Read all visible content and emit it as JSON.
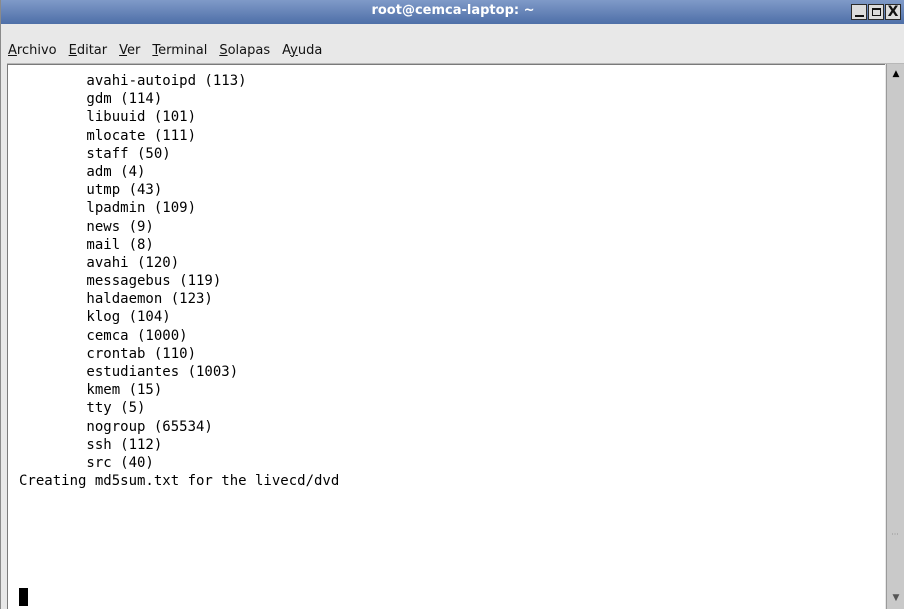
{
  "window": {
    "title": "root@cemca-laptop: ~",
    "minimize_label": "_",
    "maximize_label": "□",
    "close_label": "X"
  },
  "menubar": {
    "items": [
      {
        "label": "Archivo",
        "mnemonic": "A"
      },
      {
        "label": "Editar",
        "mnemonic": "E"
      },
      {
        "label": "Ver",
        "mnemonic": "V"
      },
      {
        "label": "Terminal",
        "mnemonic": "T"
      },
      {
        "label": "Solapas",
        "mnemonic": "S"
      },
      {
        "label": "Ayuda",
        "mnemonic": "y"
      }
    ]
  },
  "terminal": {
    "lines": [
      "        avahi-autoipd (113)",
      "        gdm (114)",
      "        libuuid (101)",
      "        mlocate (111)",
      "        staff (50)",
      "        adm (4)",
      "        utmp (43)",
      "        lpadmin (109)",
      "        news (9)",
      "        mail (8)",
      "        avahi (120)",
      "        messagebus (119)",
      "        haldaemon (123)",
      "        klog (104)",
      "        cemca (1000)",
      "        crontab (110)",
      "        estudiantes (1003)",
      "        kmem (15)",
      "        tty (5)",
      "        nogroup (65534)",
      "        ssh (112)",
      "        src (40)",
      "Creating md5sum.txt for the livecd/dvd"
    ]
  },
  "scrollbar": {
    "up_icon": "arrow-up-icon",
    "down_icon": "arrow-down-icon",
    "position": 1.0
  },
  "colors": {
    "titlebar": "#5b79b2",
    "terminal_bg": "#ffffff",
    "terminal_fg": "#000000"
  }
}
